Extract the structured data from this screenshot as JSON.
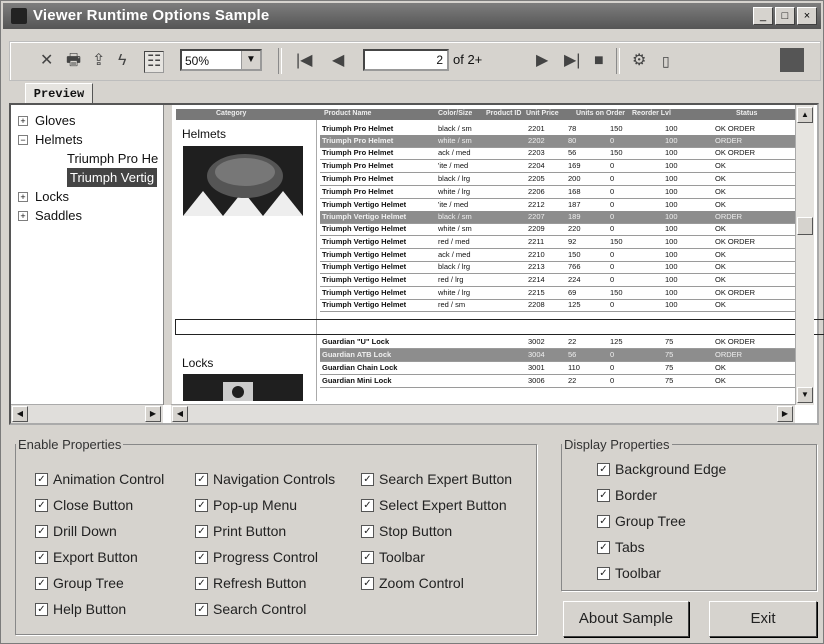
{
  "window": {
    "title": "Viewer Runtime Options Sample",
    "controls": [
      "_",
      "□",
      "×"
    ]
  },
  "toolbar": {
    "zoom": "50%",
    "page_current": "2",
    "page_total": "of 2+"
  },
  "tab": {
    "label": "Preview"
  },
  "tree": {
    "items": [
      {
        "label": "Gloves",
        "expander": "+",
        "child": false,
        "selected": false
      },
      {
        "label": "Helmets",
        "expander": "−",
        "child": false,
        "selected": false
      },
      {
        "label": "Triumph Pro He",
        "expander": "",
        "child": true,
        "selected": false
      },
      {
        "label": "Triumph Vertig",
        "expander": "",
        "child": true,
        "selected": true
      },
      {
        "label": "Locks",
        "expander": "+",
        "child": false,
        "selected": false
      },
      {
        "label": "Saddles",
        "expander": "+",
        "child": false,
        "selected": false
      }
    ]
  },
  "report": {
    "headers": [
      "Category",
      "Product Name",
      "Color/Size",
      "Product ID",
      "Unit Price",
      "Units on Order",
      "Reorder Lvl",
      "Status"
    ],
    "category_helmets": "Helmets",
    "category_locks": "Locks",
    "rows": [
      {
        "name": "Triumph Pro Helmet",
        "size": "black / sm",
        "id": "2201",
        "price": "78",
        "order": "150",
        "reorder": "100",
        "status": "OK ORDER",
        "hl": false
      },
      {
        "name": "Triumph Pro Helmet",
        "size": "white / sm",
        "id": "2202",
        "price": "80",
        "order": "0",
        "reorder": "100",
        "status": "ORDER",
        "hl": true
      },
      {
        "name": "Triumph Pro Helmet",
        "size": "ack / med",
        "id": "2203",
        "price": "56",
        "order": "150",
        "reorder": "100",
        "status": "OK ORDER",
        "hl": false
      },
      {
        "name": "Triumph Pro Helmet",
        "size": "'ite / med",
        "id": "2204",
        "price": "169",
        "order": "0",
        "reorder": "100",
        "status": "OK",
        "hl": false
      },
      {
        "name": "Triumph Pro Helmet",
        "size": "black / lrg",
        "id": "2205",
        "price": "200",
        "order": "0",
        "reorder": "100",
        "status": "OK",
        "hl": false
      },
      {
        "name": "Triumph Pro Helmet",
        "size": "white / lrg",
        "id": "2206",
        "price": "168",
        "order": "0",
        "reorder": "100",
        "status": "OK",
        "hl": false
      },
      {
        "name": "Triumph Vertigo Helmet",
        "size": "'ite / med",
        "id": "2212",
        "price": "187",
        "order": "0",
        "reorder": "100",
        "status": "OK",
        "hl": false
      },
      {
        "name": "Triumph Vertigo Helmet",
        "size": "black / sm",
        "id": "2207",
        "price": "189",
        "order": "0",
        "reorder": "100",
        "status": "ORDER",
        "hl": true
      },
      {
        "name": "Triumph Vertigo Helmet",
        "size": "white / sm",
        "id": "2209",
        "price": "220",
        "order": "0",
        "reorder": "100",
        "status": "OK",
        "hl": false
      },
      {
        "name": "Triumph Vertigo Helmet",
        "size": "red / med",
        "id": "2211",
        "price": "92",
        "order": "150",
        "reorder": "100",
        "status": "OK ORDER",
        "hl": false
      },
      {
        "name": "Triumph Vertigo Helmet",
        "size": "ack / med",
        "id": "2210",
        "price": "150",
        "order": "0",
        "reorder": "100",
        "status": "OK",
        "hl": false
      },
      {
        "name": "Triumph Vertigo Helmet",
        "size": "black / lrg",
        "id": "2213",
        "price": "766",
        "order": "0",
        "reorder": "100",
        "status": "OK",
        "hl": false
      },
      {
        "name": "Triumph Vertigo Helmet",
        "size": "red / lrg",
        "id": "2214",
        "price": "224",
        "order": "0",
        "reorder": "100",
        "status": "OK",
        "hl": false
      },
      {
        "name": "Triumph Vertigo Helmet",
        "size": "white / lrg",
        "id": "2215",
        "price": "69",
        "order": "150",
        "reorder": "100",
        "status": "OK ORDER",
        "hl": false
      },
      {
        "name": "Triumph Vertigo Helmet",
        "size": "red / sm",
        "id": "2208",
        "price": "125",
        "order": "0",
        "reorder": "100",
        "status": "OK",
        "hl": false
      },
      {
        "name": "Guardian \"U\" Lock",
        "size": "",
        "id": "3002",
        "price": "22",
        "order": "125",
        "reorder": "75",
        "status": "OK ORDER",
        "hl": false
      },
      {
        "name": "Guardian ATB Lock",
        "size": "",
        "id": "3004",
        "price": "56",
        "order": "0",
        "reorder": "75",
        "status": "ORDER",
        "hl": true
      },
      {
        "name": "Guardian Chain Lock",
        "size": "",
        "id": "3001",
        "price": "110",
        "order": "0",
        "reorder": "75",
        "status": "OK",
        "hl": false
      },
      {
        "name": "Guardian Mini Lock",
        "size": "",
        "id": "3006",
        "price": "22",
        "order": "0",
        "reorder": "75",
        "status": "OK",
        "hl": false
      }
    ]
  },
  "enable": {
    "legend": "Enable Properties",
    "items": [
      "Animation Control",
      "Close Button",
      "Drill Down",
      "Export Button",
      "Group Tree",
      "Help Button",
      "Navigation Controls",
      "Pop-up Menu",
      "Print Button",
      "Progress Control",
      "Refresh Button",
      "Search Control",
      "Search Expert Button",
      "Select Expert Button",
      "Stop Button",
      "Toolbar",
      "Zoom Control"
    ]
  },
  "display": {
    "legend": "Display Properties",
    "items": [
      "Background Edge",
      "Border",
      "Group Tree",
      "Tabs",
      "Toolbar"
    ]
  },
  "buttons": {
    "about": "About Sample",
    "exit": "Exit"
  }
}
